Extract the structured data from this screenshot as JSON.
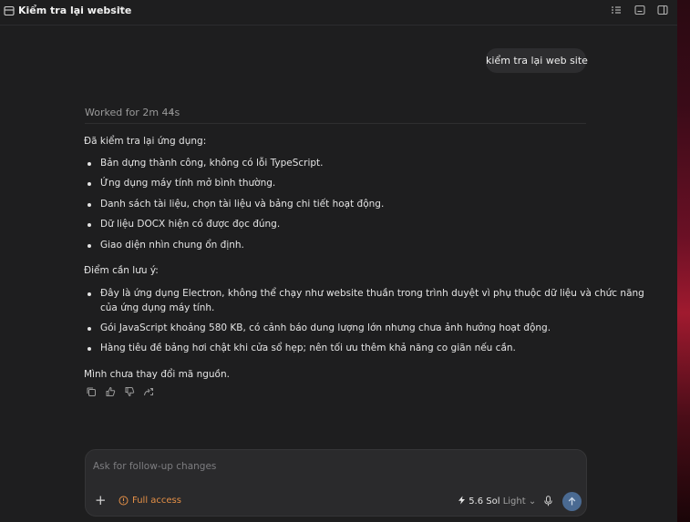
{
  "window": {
    "title": "Kiểm tra lại website",
    "more_label": "···"
  },
  "conversation": {
    "user_message": "kiểm tra lại web site",
    "worked_label": "Worked for 2m 44s",
    "worked_chevron": "›",
    "intro": "Đã kiểm tra lại ứng dụng:",
    "checks": [
      "Bản dựng thành công, không có lỗi TypeScript.",
      "Ứng dụng máy tính mở bình thường.",
      "Danh sách tài liệu, chọn tài liệu và bảng chi tiết hoạt động.",
      "Dữ liệu DOCX hiện có được đọc đúng.",
      "Giao diện nhìn chung ổn định."
    ],
    "notes_heading": "Điểm cần lưu ý:",
    "notes": [
      {
        "line1": "Đây là ứng dụng Electron, không thể chạy như website thuần trong trình duyệt vì phụ thuộc dữ liệu và chức năng",
        "line2": "của ứng dụng máy tính."
      },
      {
        "line1": "Gói JavaScript khoảng 580 KB, có cảnh báo dung lượng lớn nhưng chưa ảnh hưởng hoạt động."
      },
      {
        "line1": "Hàng tiêu đề bảng hơi chật khi cửa sổ hẹp; nên tối ưu thêm khả năng co giãn nếu cần."
      }
    ],
    "closing": "Mình chưa thay đổi mã nguồn.",
    "action_icons": [
      "copy-icon",
      "thumbs-up-icon",
      "thumbs-down-icon",
      "share-icon"
    ]
  },
  "composer": {
    "placeholder": "Ask for follow-up changes",
    "plus_label": "+",
    "access_label": "Full access",
    "model_label": "5.6 Sol",
    "reasoning_label": "Light",
    "chevron": "⌄"
  },
  "colors": {
    "background": "#1e1e1f",
    "bubble": "#2d2d2f",
    "access_orange": "#e59047",
    "send_button": "#4a6a92"
  }
}
